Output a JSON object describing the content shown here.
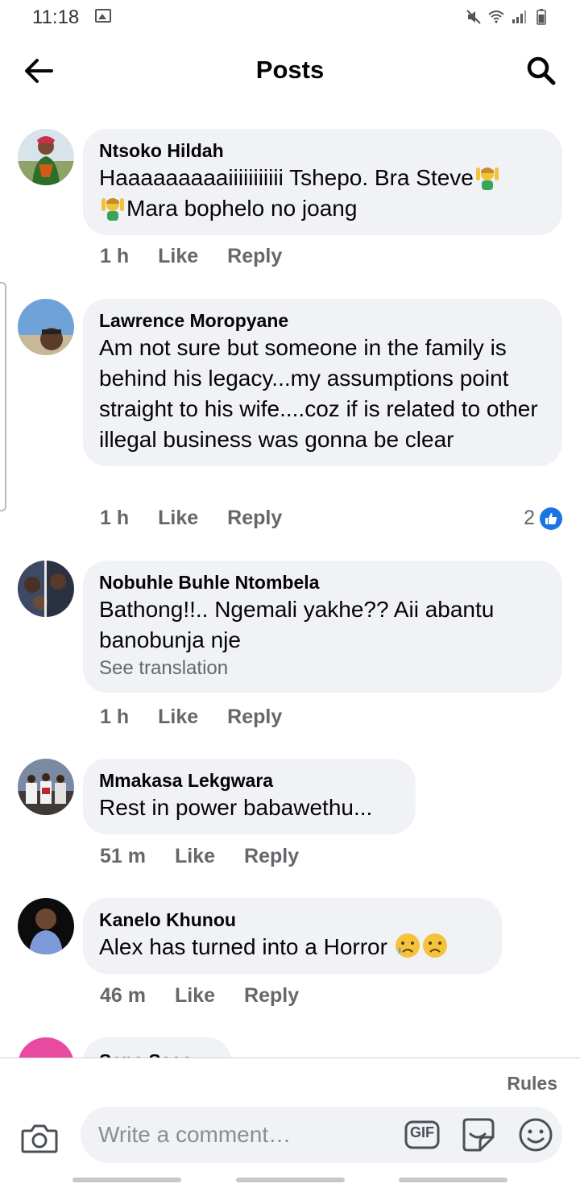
{
  "status_bar": {
    "time": "11:18"
  },
  "header": {
    "title": "Posts"
  },
  "comments": [
    {
      "author": "Ntsoko Hildah",
      "text_1": "Haaaaaaaaaiiiiiiiiiii Tshepo. Bra Steve",
      "text_2": "Mara bophelo no joang",
      "time": "1 h",
      "like_label": "Like",
      "reply_label": "Reply"
    },
    {
      "author": "Lawrence Moropyane",
      "text": "Am not sure but someone in the family is behind his legacy...my assumptions point straight to his wife....coz if is related to other illegal business was gonna be clear",
      "time": "1 h",
      "like_label": "Like",
      "reply_label": "Reply",
      "reactions": "2"
    },
    {
      "author": "Nobuhle Buhle Ntombela",
      "text": "Bathong!!.. Ngemali yakhe?? Aii abantu banobunja nje",
      "see_translation": "See translation",
      "time": "1 h",
      "like_label": "Like",
      "reply_label": "Reply"
    },
    {
      "author": "Mmakasa Lekgwara",
      "text": "Rest in power babawethu...",
      "time": "51 m",
      "like_label": "Like",
      "reply_label": "Reply"
    },
    {
      "author": "Kanelo Khunou",
      "text": "Alex has turned into a Horror",
      "time": "46 m",
      "like_label": "Like",
      "reply_label": "Reply"
    },
    {
      "author": "Sane Saso"
    }
  ],
  "composer": {
    "rules_label": "Rules",
    "placeholder": "Write a comment…",
    "gif_label": "GIF"
  },
  "colors": {
    "accent": "#1b74e4",
    "bubble": "#f0f2f5",
    "secondary_text": "#65676b"
  }
}
